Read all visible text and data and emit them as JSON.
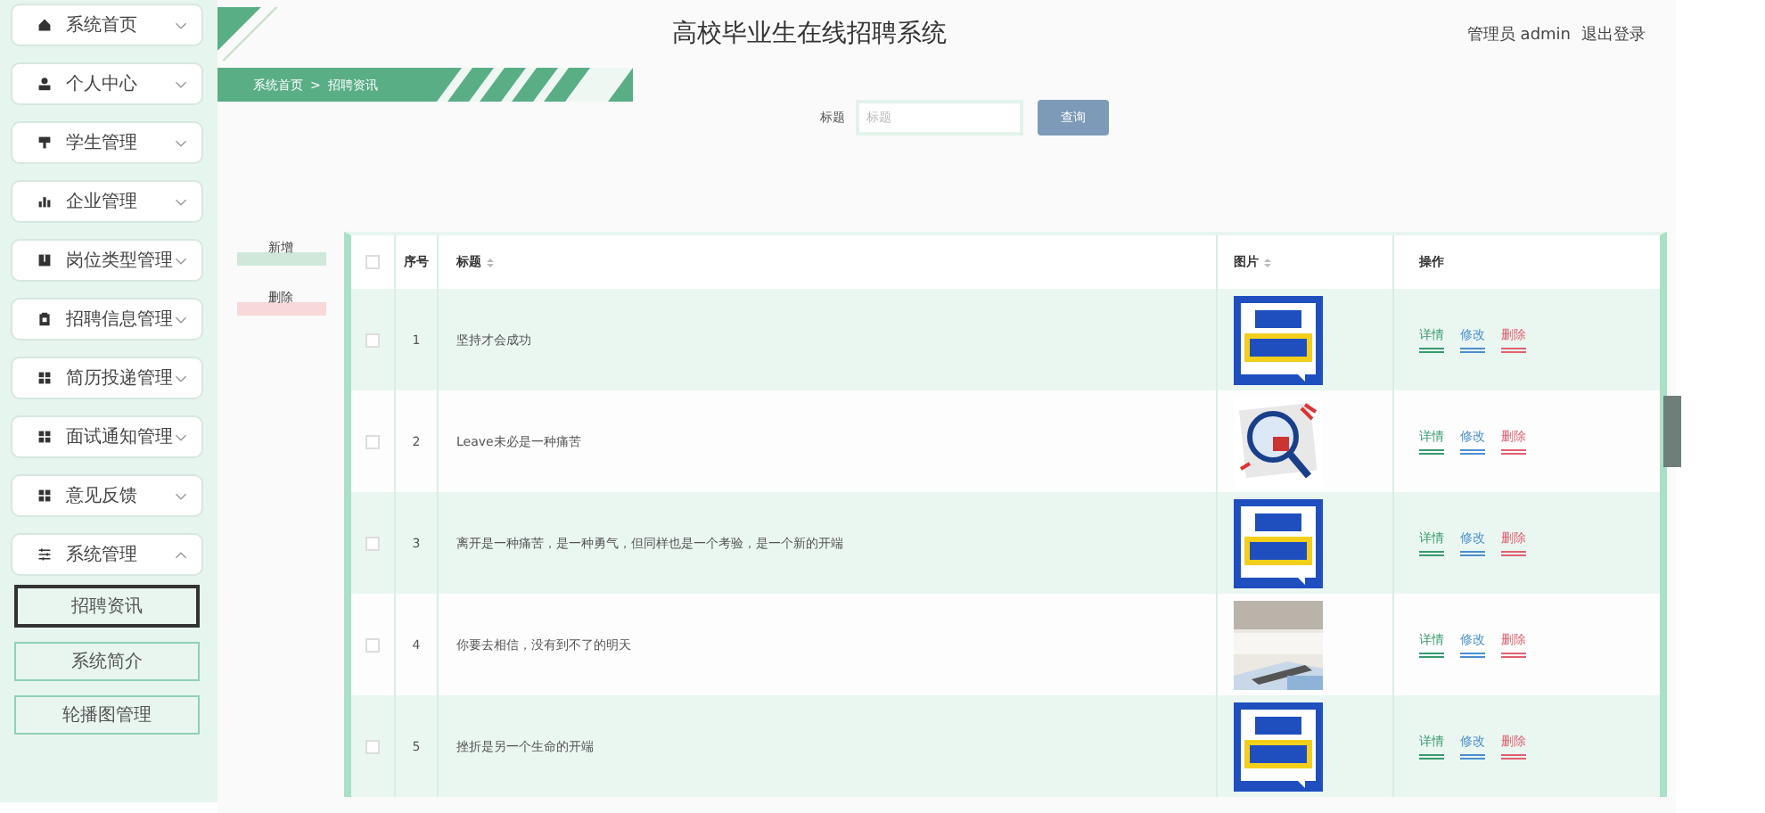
{
  "sidebar": {
    "items": [
      {
        "label": "系统首页",
        "expanded": false
      },
      {
        "label": "个人中心",
        "expanded": false
      },
      {
        "label": "学生管理",
        "expanded": false
      },
      {
        "label": "企业管理",
        "expanded": false
      },
      {
        "label": "岗位类型管理",
        "expanded": false
      },
      {
        "label": "招聘信息管理",
        "expanded": false
      },
      {
        "label": "简历投递管理",
        "expanded": false
      },
      {
        "label": "面试通知管理",
        "expanded": false
      },
      {
        "label": "意见反馈",
        "expanded": false
      },
      {
        "label": "系统管理",
        "expanded": true,
        "children": [
          {
            "label": "招聘资讯",
            "selected": true
          },
          {
            "label": "系统简介",
            "selected": false
          },
          {
            "label": "轮播图管理",
            "selected": false
          }
        ]
      }
    ]
  },
  "header": {
    "title": "高校毕业生在线招聘系统",
    "user": "管理员 admin",
    "logout": "退出登录"
  },
  "breadcrumb": [
    "系统首页",
    ">",
    "招聘资讯"
  ],
  "search": {
    "label": "标题",
    "placeholder": "标题",
    "button": "查询"
  },
  "actions": [
    "新增",
    "删除"
  ],
  "table": {
    "select_all": false,
    "columns": [
      "序号",
      "标题",
      "图片",
      "操作"
    ],
    "rows": [
      {
        "checked": false,
        "index": "1",
        "title": "坚持才会成功",
        "image": {
          "kind": "picture"
        },
        "actions": [
          "详情",
          "修改",
          "删除"
        ]
      },
      {
        "checked": false,
        "index": "2",
        "title": "Leave未必是一种痛苦",
        "image": {
          "kind": "picture"
        },
        "actions": [
          "详情",
          "修改",
          "删除"
        ]
      },
      {
        "checked": false,
        "index": "3",
        "title": "离开是一种痛苦，是一种勇气，但同样也是一个考验，是一个新的开端",
        "image": {
          "kind": "picture"
        },
        "actions": [
          "详情",
          "修改",
          "删除"
        ]
      },
      {
        "checked": false,
        "index": "4",
        "title": "你要去相信，没有到不了的明天",
        "image": {
          "kind": "picture"
        },
        "actions": [
          "详情",
          "修改",
          "删除"
        ]
      },
      {
        "checked": false,
        "index": "5",
        "title": "挫折是另一个生命的开端",
        "image": {
          "kind": "picture"
        },
        "actions": [
          "详情",
          "修改",
          "删除"
        ]
      }
    ]
  }
}
